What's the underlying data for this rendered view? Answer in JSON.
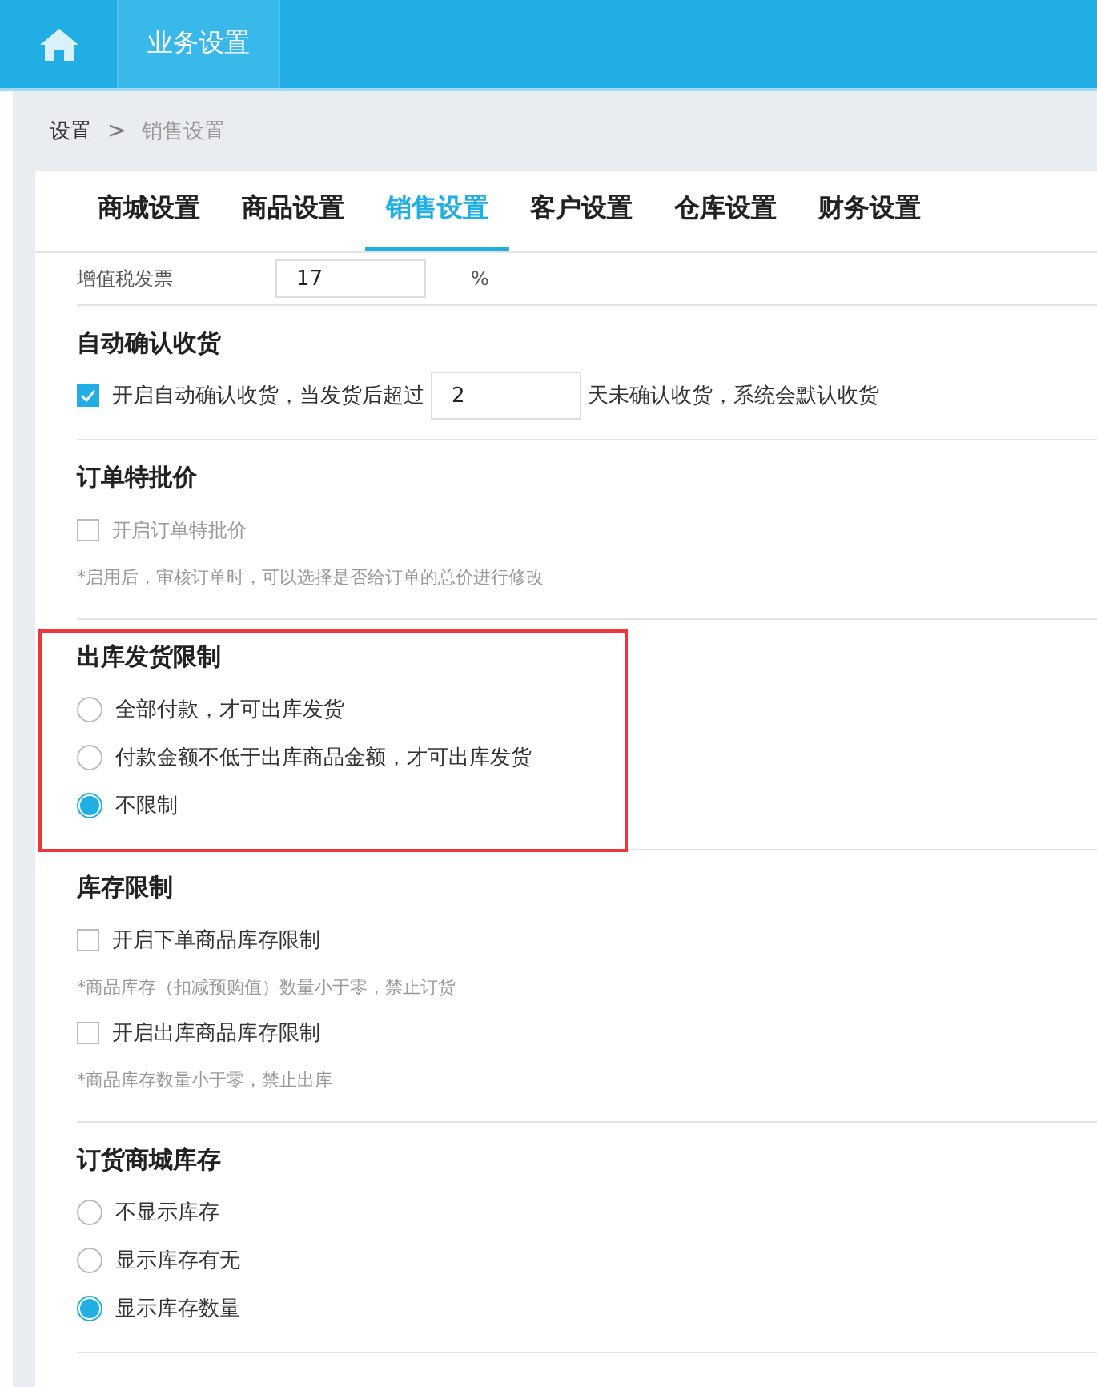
{
  "header": {
    "title": "业务设置"
  },
  "breadcrumb": {
    "items": [
      "设置",
      "销售设置"
    ],
    "separator": ">"
  },
  "tabs": [
    {
      "label": "商城设置",
      "selected": false
    },
    {
      "label": "商品设置",
      "selected": false
    },
    {
      "label": "销售设置",
      "selected": true
    },
    {
      "label": "客户设置",
      "selected": false
    },
    {
      "label": "仓库设置",
      "selected": false
    },
    {
      "label": "财务设置",
      "selected": false
    }
  ],
  "partial_row": {
    "label": "增值税发票",
    "value": "17",
    "unit": "%"
  },
  "sections": [
    {
      "title": "自动确认收货",
      "highlighted": false,
      "items": [
        {
          "kind": "checkbox",
          "checked": true,
          "label": "开启自动确认收货，当发货后超过",
          "value": "2",
          "suffix": "天未确认收货，系统会默认收货",
          "disabled": false
        }
      ]
    },
    {
      "title": "订单特批价",
      "highlighted": false,
      "items": [
        {
          "kind": "checkbox",
          "checked": false,
          "label": "开启订单特批价",
          "disabled": true
        },
        {
          "kind": "note",
          "text": "*启用后，审核订单时，可以选择是否给订单的总价进行修改"
        }
      ]
    },
    {
      "title": "出库发货限制",
      "highlighted": true,
      "items": [
        {
          "kind": "radio",
          "selected": false,
          "label": "全部付款，才可出库发货"
        },
        {
          "kind": "radio",
          "selected": false,
          "label": "付款金额不低于出库商品金额，才可出库发货"
        },
        {
          "kind": "radio",
          "selected": true,
          "label": "不限制"
        }
      ]
    },
    {
      "title": "库存限制",
      "highlighted": false,
      "items": [
        {
          "kind": "checkbox",
          "checked": false,
          "label": "开启下单商品库存限制",
          "disabled": false
        },
        {
          "kind": "note",
          "text": "*商品库存（扣减预购值）数量小于零，禁止订货"
        },
        {
          "kind": "checkbox",
          "checked": false,
          "label": "开启出库商品库存限制",
          "disabled": false
        },
        {
          "kind": "note",
          "text": "*商品库存数量小于零，禁止出库"
        }
      ]
    },
    {
      "title": "订货商城库存",
      "highlighted": false,
      "items": [
        {
          "kind": "radio",
          "selected": false,
          "label": "不显示库存"
        },
        {
          "kind": "radio",
          "selected": false,
          "label": "显示库存有无"
        },
        {
          "kind": "radio",
          "selected": true,
          "label": "显示库存数量"
        }
      ]
    }
  ]
}
